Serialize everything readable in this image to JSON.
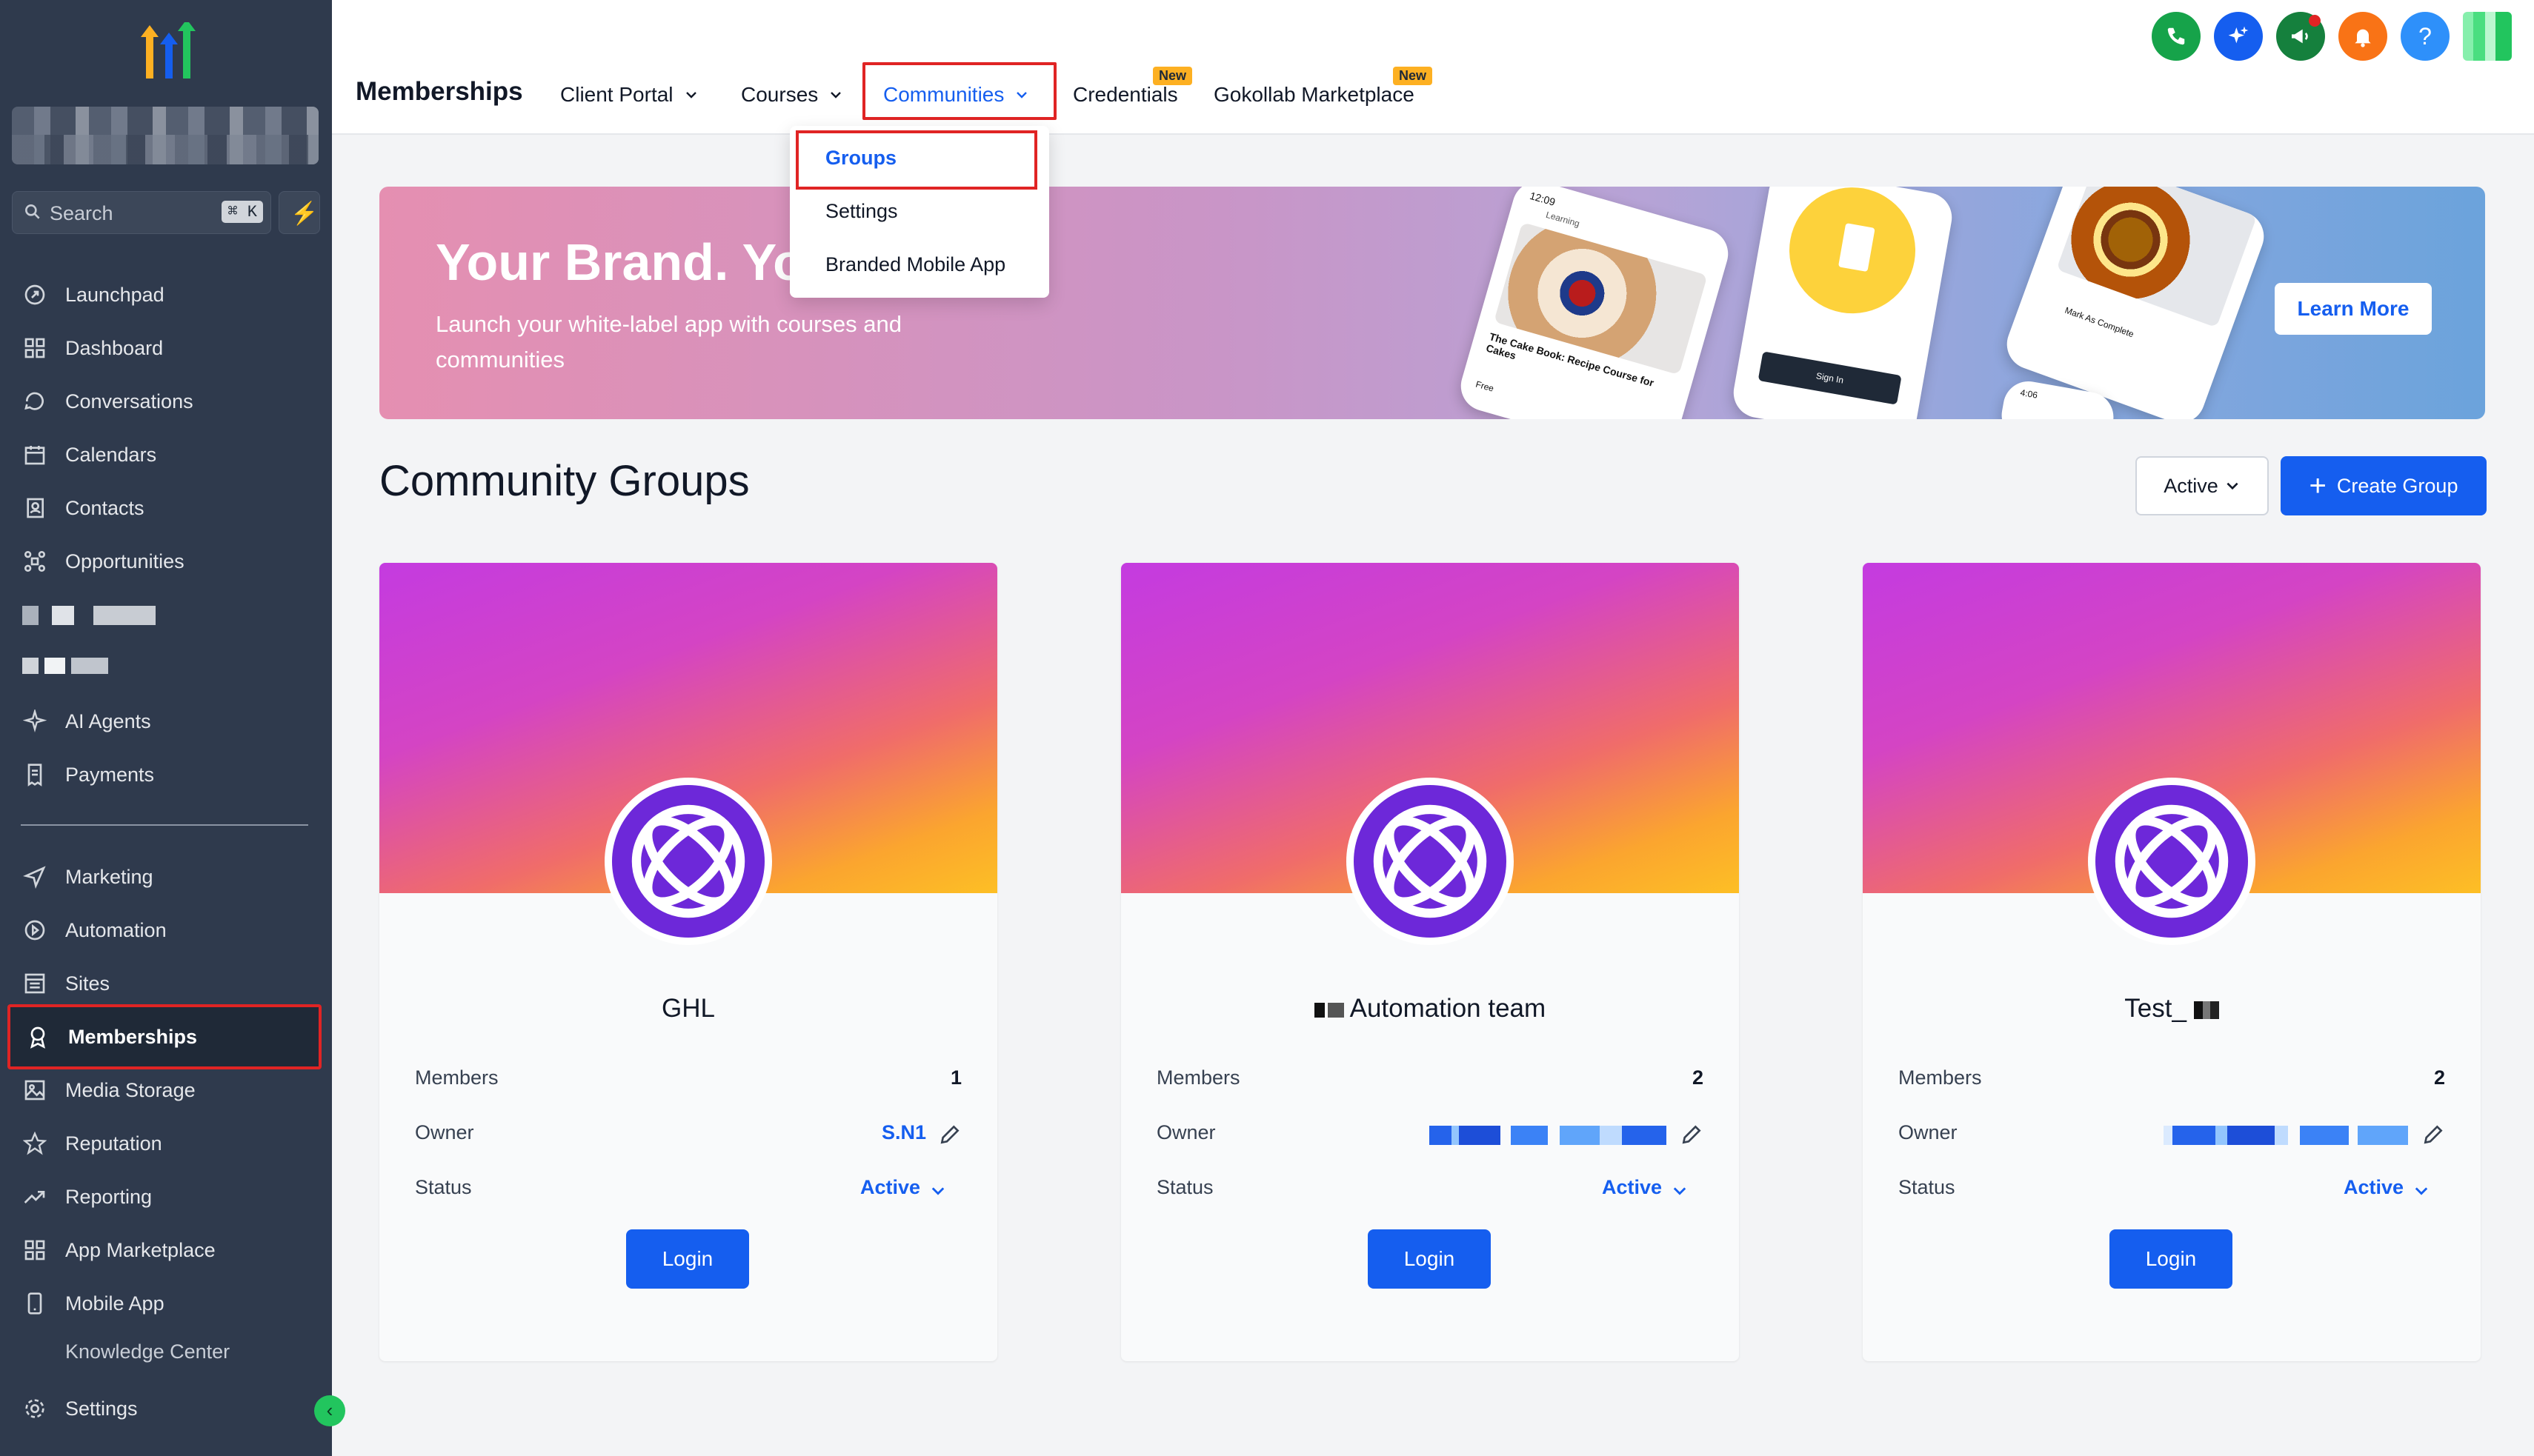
{
  "sidebar": {
    "search_placeholder": "Search",
    "search_shortcut": "⌘ K",
    "items": [
      {
        "label": "Launchpad",
        "icon": "launchpad-icon"
      },
      {
        "label": "Dashboard",
        "icon": "dashboard-icon"
      },
      {
        "label": "Conversations",
        "icon": "chat-icon"
      },
      {
        "label": "Calendars",
        "icon": "calendar-icon"
      },
      {
        "label": "Contacts",
        "icon": "contacts-icon"
      },
      {
        "label": "Opportunities",
        "icon": "opportunities-icon"
      },
      {
        "label": "AI Agents",
        "icon": "sparkle-icon"
      },
      {
        "label": "Payments",
        "icon": "receipt-icon"
      },
      {
        "label": "Marketing",
        "icon": "send-icon"
      },
      {
        "label": "Automation",
        "icon": "automation-icon"
      },
      {
        "label": "Sites",
        "icon": "sites-icon"
      },
      {
        "label": "Memberships",
        "icon": "award-icon"
      },
      {
        "label": "Media Storage",
        "icon": "image-icon"
      },
      {
        "label": "Reputation",
        "icon": "star-icon"
      },
      {
        "label": "Reporting",
        "icon": "trending-icon"
      },
      {
        "label": "App Marketplace",
        "icon": "grid-icon"
      },
      {
        "label": "Mobile App",
        "icon": "mobile-icon"
      },
      {
        "label": "Knowledge Center",
        "icon": "book-icon"
      },
      {
        "label": "Settings",
        "icon": "gear-icon"
      }
    ],
    "active_item": "Memberships"
  },
  "topbar": {
    "title": "Memberships",
    "tabs": [
      {
        "label": "Client Portal",
        "has_dropdown": true
      },
      {
        "label": "Courses",
        "has_dropdown": true
      },
      {
        "label": "Communities",
        "has_dropdown": true,
        "active": true
      },
      {
        "label": "Credentials",
        "badge": "New"
      },
      {
        "label": "Gokollab Marketplace",
        "badge": "New"
      }
    ],
    "icons": [
      {
        "name": "phone-icon",
        "color": "#16a34a"
      },
      {
        "name": "ai-sparkle-icon",
        "color": "#155eef"
      },
      {
        "name": "megaphone-icon",
        "color": "#15803d"
      },
      {
        "name": "bell-icon",
        "color": "#f97316"
      },
      {
        "name": "help-icon",
        "color": "#2e90fa"
      }
    ]
  },
  "communities_dropdown": {
    "items": [
      "Groups",
      "Settings",
      "Branded Mobile App"
    ],
    "selected": "Groups"
  },
  "banner": {
    "title": "Your Brand. Your",
    "subtitle": "Launch your white-label app with courses and communities",
    "cta": "Learn More",
    "phone_text": "The Cake Book: Recipe Course for Cakes",
    "phone_time": "12:09",
    "phone_signin": "Sign In",
    "phone_mark": "Mark As Complete",
    "phone_learning": "Learning",
    "phone_free": "Free",
    "phone_time2": "4:06"
  },
  "main": {
    "section_title": "Community Groups",
    "status_filter": "Active",
    "create_label": "Create Group"
  },
  "cards": [
    {
      "name": "GHL",
      "members_label": "Members",
      "members": "1",
      "owner_label": "Owner",
      "owner": "S.N1",
      "status_label": "Status",
      "status": "Active",
      "login": "Login"
    },
    {
      "name": "Automation team",
      "members_label": "Members",
      "members": "2",
      "owner_label": "Owner",
      "owner": "",
      "status_label": "Status",
      "status": "Active",
      "login": "Login"
    },
    {
      "name": "Test_",
      "members_label": "Members",
      "members": "2",
      "owner_label": "Owner",
      "owner": "",
      "status_label": "Status",
      "status": "Active",
      "login": "Login"
    }
  ],
  "colors": {
    "sidebar_bg": "#2f3a4d",
    "primary": "#155eef",
    "highlight_box": "#e02424"
  }
}
